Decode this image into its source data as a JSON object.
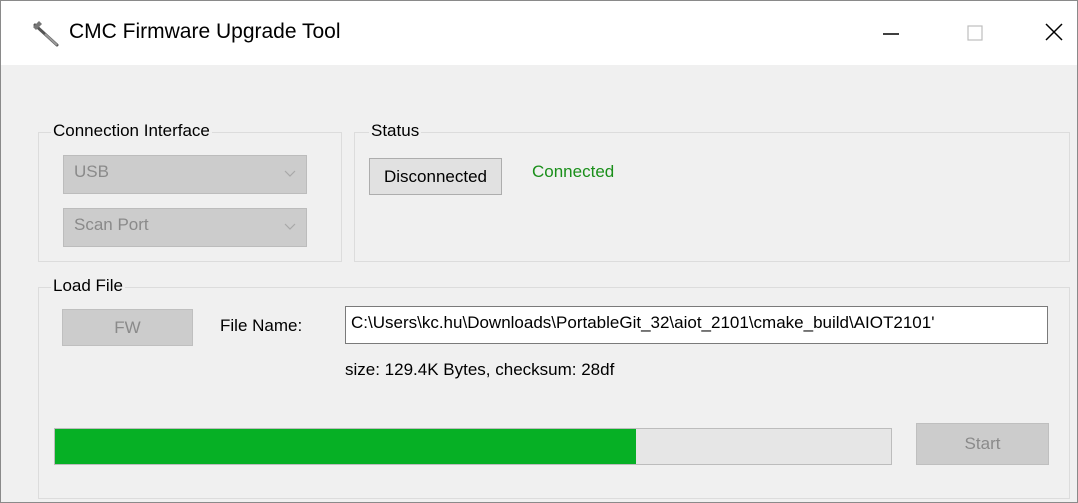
{
  "window": {
    "title": "CMC Firmware Upgrade Tool",
    "app_icon": "wrench-tool-icon",
    "controls": {
      "minimize_icon": "minimize-icon",
      "maximize_icon": "maximize-icon",
      "close_icon": "close-icon"
    }
  },
  "connection": {
    "group_label": "Connection Interface",
    "interface_value": "USB",
    "port_value": "Scan Port"
  },
  "status": {
    "group_label": "Status",
    "button_label": "Disconnected",
    "state_text": "Connected",
    "state_color": "#1a8f1a"
  },
  "load_file": {
    "group_label": "Load File",
    "fw_button_label": "FW",
    "file_name_label": "File Name:",
    "file_path": "C:\\Users\\kc.hu\\Downloads\\PortableGit_32\\aiot_2101\\cmake_build\\AIOT2101'",
    "file_info": "size: 129.4K Bytes, checksum: 28df",
    "progress_percent": 69.5,
    "progress_color": "#06b025",
    "start_button_label": "Start"
  }
}
